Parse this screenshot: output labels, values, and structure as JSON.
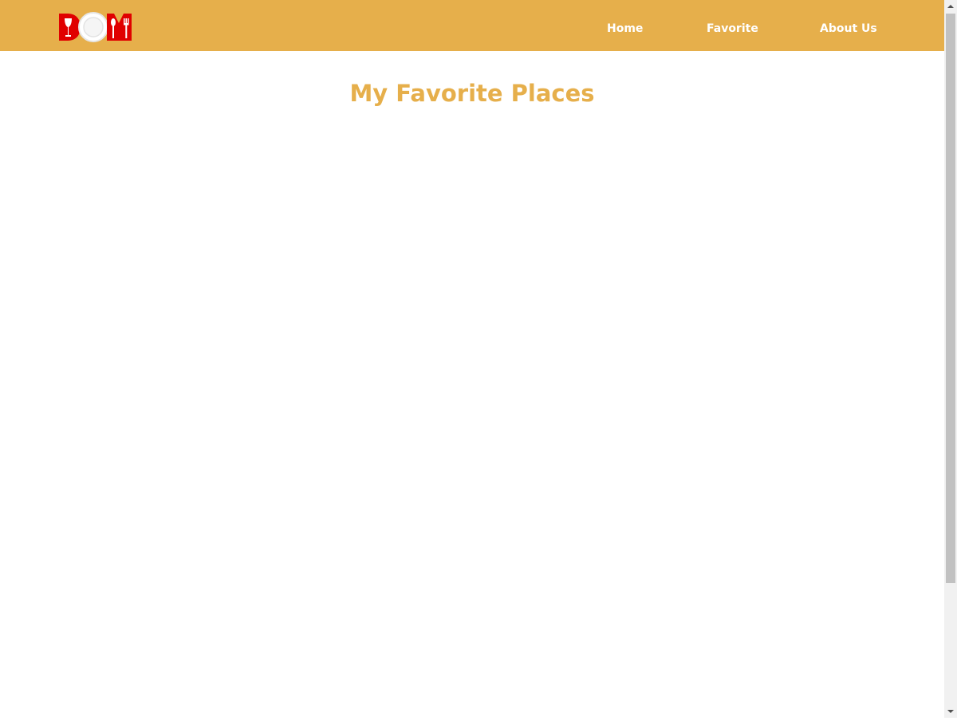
{
  "header": {
    "logo": {
      "text": "DOM",
      "icon": "restaurant-logo",
      "colors": {
        "primary": "#e00000",
        "plate": "#ffffff"
      }
    },
    "nav": {
      "home": "Home",
      "favorite": "Favorite",
      "about": "About Us"
    },
    "background": "#e6af4b"
  },
  "main": {
    "title": "My Favorite Places",
    "title_color": "#e6af4b"
  },
  "scrollbar": {
    "up_icon": "scroll-up-arrow-icon",
    "down_icon": "scroll-down-arrow-icon"
  }
}
